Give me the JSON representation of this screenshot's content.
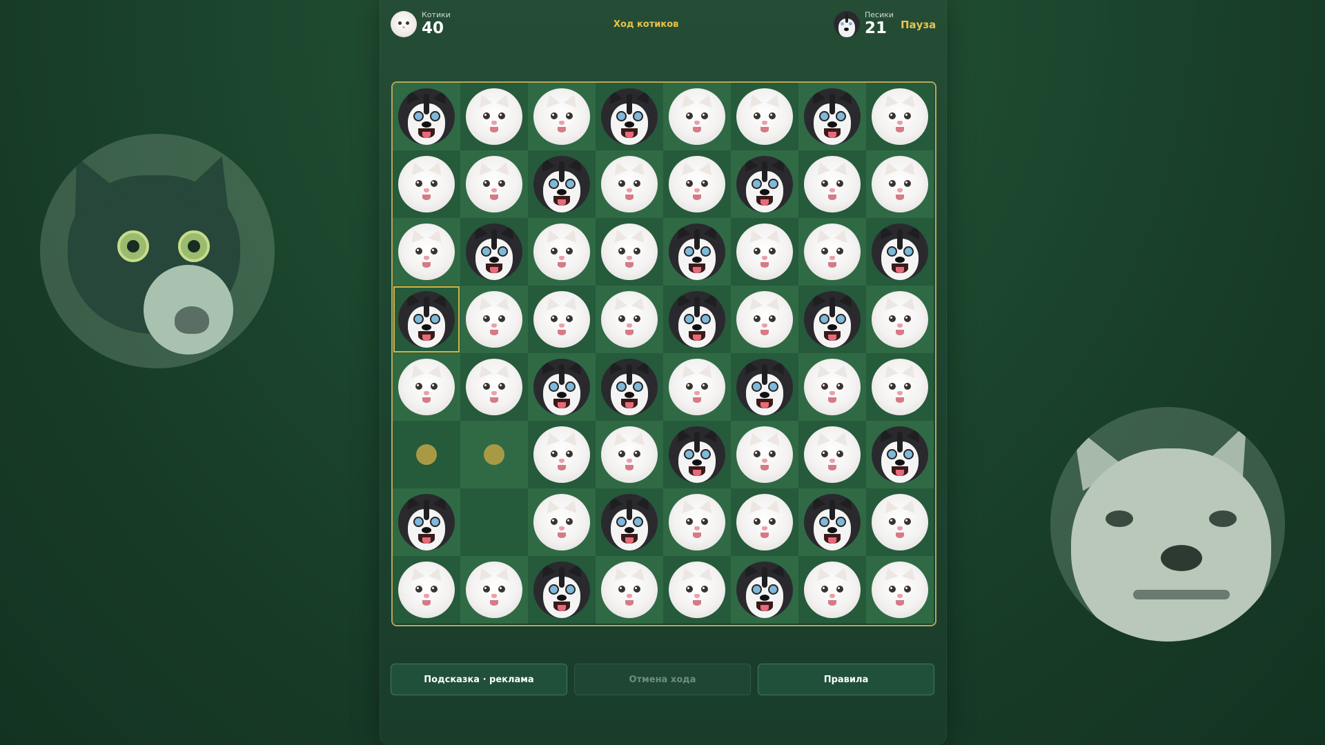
{
  "header": {
    "cats": {
      "name": "Котики",
      "score": "40",
      "avatar_icon": "white-cat-icon"
    },
    "turn": "Ход котиков",
    "dogs": {
      "name": "Песики",
      "score": "21",
      "avatar_icon": "husky-icon"
    },
    "pause_label": "Пауза"
  },
  "board": {
    "size": 8,
    "legend": {
      "C": "cat",
      "D": "dog",
      "H": "hint",
      "E": "empty"
    },
    "rows": [
      [
        "D",
        "C",
        "C",
        "D",
        "C",
        "C",
        "D",
        "C"
      ],
      [
        "C",
        "C",
        "D",
        "C",
        "C",
        "D",
        "C",
        "C"
      ],
      [
        "C",
        "D",
        "C",
        "C",
        "D",
        "C",
        "C",
        "D"
      ],
      [
        "D",
        "C",
        "C",
        "C",
        "D",
        "C",
        "D",
        "C"
      ],
      [
        "C",
        "C",
        "D",
        "D",
        "C",
        "D",
        "C",
        "C"
      ],
      [
        "H",
        "H",
        "C",
        "C",
        "D",
        "C",
        "C",
        "D"
      ],
      [
        "D",
        "E",
        "C",
        "D",
        "C",
        "C",
        "D",
        "C"
      ],
      [
        "C",
        "C",
        "D",
        "C",
        "C",
        "D",
        "C",
        "C"
      ]
    ],
    "selected": {
      "row": 3,
      "col": 0
    },
    "colors": {
      "border": "#b8a858",
      "hint_dot": "#a89a45",
      "selected": "#d4b445"
    }
  },
  "buttons": {
    "hint_label": "Подсказка · реклама",
    "undo_label": "Отмена хода",
    "rules_label": "Правила"
  },
  "accent_color": "#e8c24e"
}
